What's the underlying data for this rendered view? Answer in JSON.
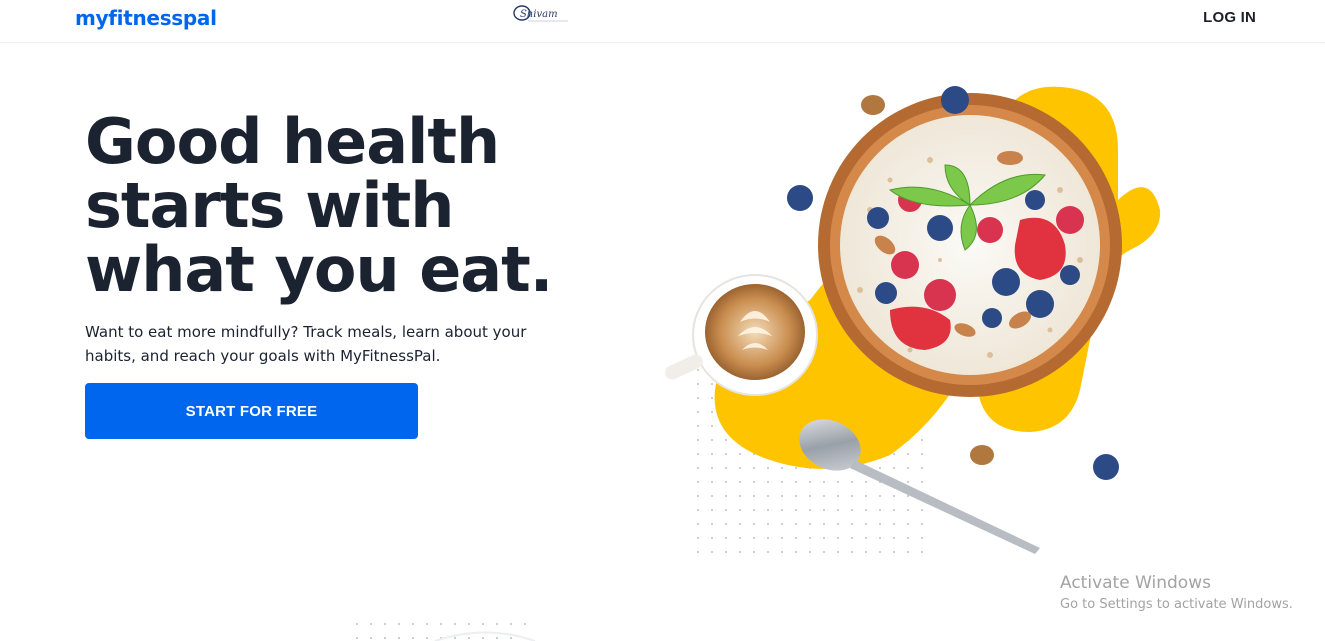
{
  "header": {
    "logo": "myfitnesspal",
    "partner_logo_text": "Shivam",
    "login_label": "LOG IN"
  },
  "hero": {
    "title_lines": [
      "Good health",
      "starts with",
      "what you eat."
    ],
    "subtitle": "Want to eat more mindfully? Track meals, learn about your habits, and reach your goals with MyFitnessPal.",
    "cta_label": "START FOR FREE"
  },
  "watermark": {
    "title": "Activate Windows",
    "subtitle": "Go to Settings to activate Windows."
  },
  "colors": {
    "brand_blue": "#0066EE",
    "accent_yellow": "#FFC400",
    "text_dark": "#1B2230"
  },
  "images": {
    "hero_art": "breakfast-bowl-with-berries-coffee-spoon"
  }
}
